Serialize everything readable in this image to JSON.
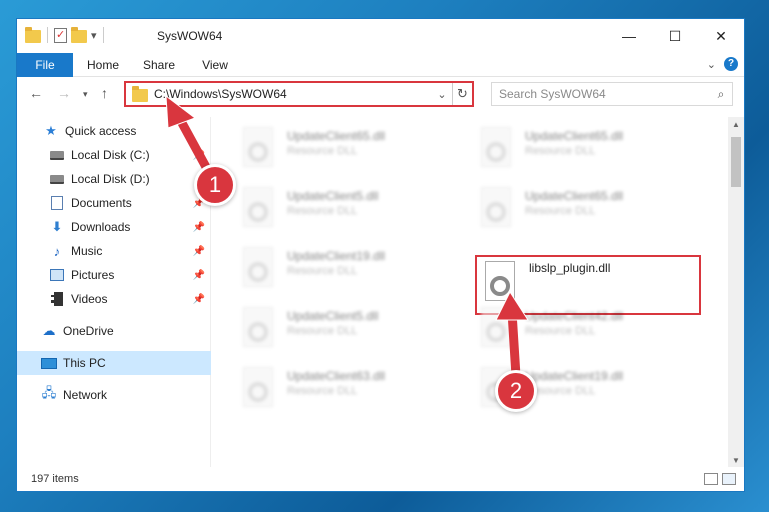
{
  "window": {
    "title": "SysWOW64",
    "controls": {
      "minimize": "—",
      "maximize": "☐",
      "close": "✕"
    }
  },
  "ribbon": {
    "tabs": [
      "File",
      "Home",
      "Share",
      "View"
    ],
    "expand_icon": "chevron-down-icon",
    "help_label": "?"
  },
  "address": {
    "path": "C:\\Windows\\SysWOW64",
    "search_placeholder": "Search SysWOW64"
  },
  "sidebar": {
    "items": [
      {
        "label": "Quick access",
        "icon": "star-icon",
        "pinned": false
      },
      {
        "label": "Local Disk (C:)",
        "icon": "disk-icon",
        "pinned": true
      },
      {
        "label": "Local Disk (D:)",
        "icon": "disk-icon",
        "pinned": false
      },
      {
        "label": "Documents",
        "icon": "documents-icon",
        "pinned": true
      },
      {
        "label": "Downloads",
        "icon": "downloads-icon",
        "pinned": true
      },
      {
        "label": "Music",
        "icon": "music-icon",
        "pinned": true
      },
      {
        "label": "Pictures",
        "icon": "pictures-icon",
        "pinned": true
      },
      {
        "label": "Videos",
        "icon": "videos-icon",
        "pinned": true
      },
      {
        "label": "OneDrive",
        "icon": "onedrive-icon",
        "pinned": false
      },
      {
        "label": "This PC",
        "icon": "this-pc-icon",
        "pinned": false,
        "selected": true
      },
      {
        "label": "Network",
        "icon": "network-icon",
        "pinned": false
      }
    ]
  },
  "files": {
    "col1": [
      {
        "name": "UpdateClient65.dll",
        "type": "Resource DLL"
      },
      {
        "name": "UpdateClient5.dll",
        "type": "Resource DLL"
      },
      {
        "name": "UpdateClient19.dll",
        "type": "Resource DLL"
      },
      {
        "name": "UpdateClient5.dll",
        "type": "Resource DLL"
      },
      {
        "name": "UpdateClient63.dll",
        "type": "Resource DLL"
      }
    ],
    "col2": [
      {
        "name": "UpdateClient65.dll",
        "type": "Resource DLL"
      },
      {
        "name": "UpdateClient65.dll",
        "type": "Resource DLL"
      },
      {
        "name": "libslp_plugin.dll",
        "type": ""
      },
      {
        "name": "UpdateClient42.dll",
        "type": "Resource DLL"
      },
      {
        "name": "UpdateClient19.dll",
        "type": "Resource DLL"
      }
    ]
  },
  "status": {
    "item_count": "197 items"
  },
  "callouts": {
    "one": "1",
    "two": "2"
  },
  "colors": {
    "accent": "#1979ca",
    "highlight": "#d9363e"
  }
}
